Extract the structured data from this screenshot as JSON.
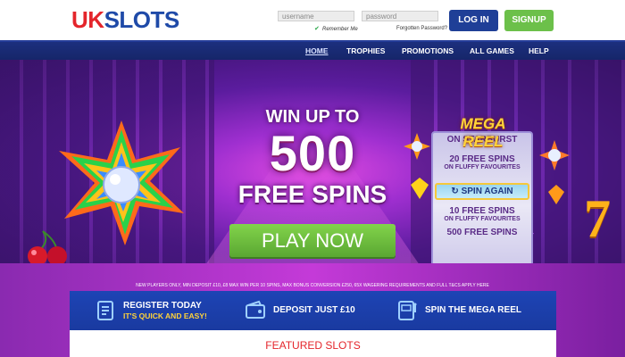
{
  "brand": {
    "uk": "UK",
    "slots": "SLOTS"
  },
  "login": {
    "username_placeholder": "username",
    "password_placeholder": "password",
    "remember_label": "Remember Me",
    "forgot_label": "Forgotten Password?",
    "login_button": "LOG IN",
    "signup_button": "SIGNUP"
  },
  "nav": {
    "items": [
      {
        "label": "HOME"
      },
      {
        "label": "TROPHIES"
      },
      {
        "label": "PROMOTIONS"
      },
      {
        "label": "ALL GAMES"
      },
      {
        "label": "HELP"
      }
    ]
  },
  "hero": {
    "line1": "WIN UP TO",
    "big": "500",
    "line3": "FREE SPINS",
    "cta": "PLAY NOW",
    "disclaimer": "NEW PLAYERS ONLY, MIN DEPOSIT £10, £8 MAX WIN PER 10 SPINS, MAX BONUS CONVERSION £250, 65X WAGERING REQUIREMENTS AND FULL T&CS APPLY HERE"
  },
  "reel": {
    "title": "MEGA REEL",
    "row1_sub": "ON STARBURST",
    "row2_main": "20 FREE SPINS",
    "row2_sub": "ON FLUFFY FAVOURITES",
    "spin_again": "SPIN AGAIN",
    "row3_main": "10 FREE SPINS",
    "row3_sub": "ON FLUFFY FAVOURITES",
    "row4_main": "500 FREE SPINS"
  },
  "steps": {
    "step1_line1": "REGISTER TODAY",
    "step1_line2": "IT'S QUICK AND EASY!",
    "step2_line1": "DEPOSIT JUST £10",
    "step3_line1": "SPIN THE MEGA REEL"
  },
  "featured": {
    "title": "FEATURED SLOTS"
  },
  "colors": {
    "brand_red": "#e4252b",
    "brand_blue": "#1f4aa8",
    "login_blue": "#1f3f97",
    "signup_green": "#6cc04a",
    "nav_blue": "#1c2f7e",
    "cta_green": "#6cc04a",
    "reel_gold": "#ffd33a"
  },
  "icons": [
    "check-icon",
    "starburst-gem-icon",
    "cherry-icon",
    "seven-icon",
    "register-form-icon",
    "wallet-icon",
    "slot-machine-icon",
    "spin-arrow-icon"
  ]
}
